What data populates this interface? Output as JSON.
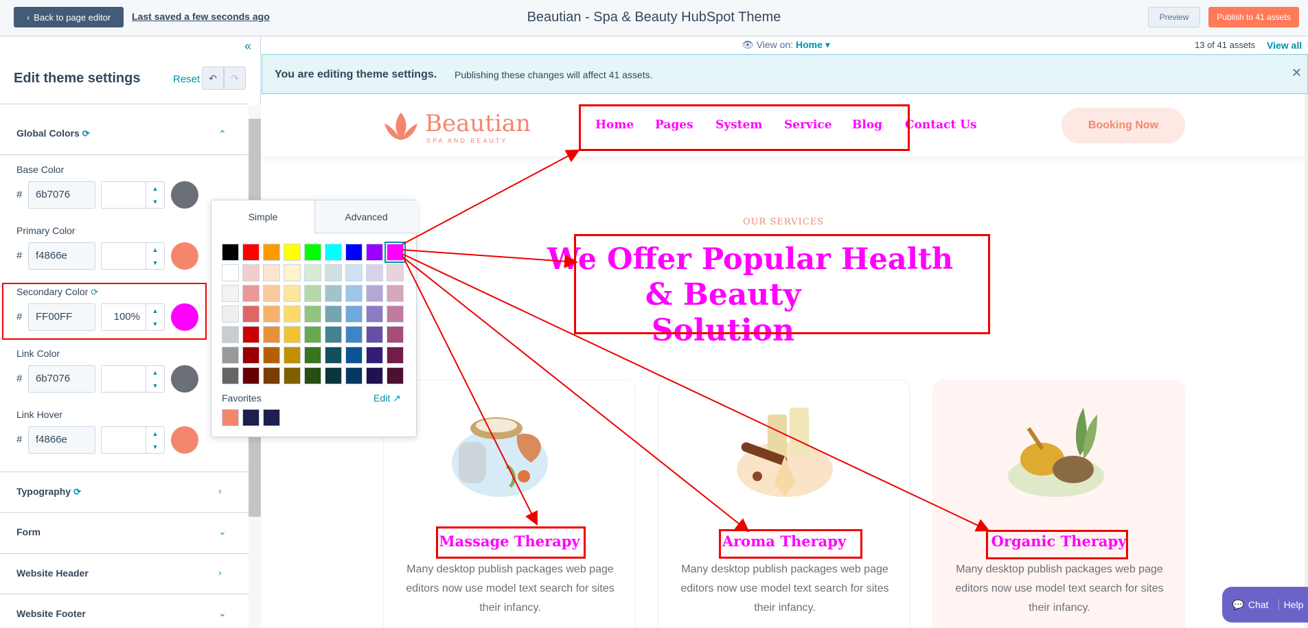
{
  "topbar": {
    "back_label": "Back to page editor",
    "saved": "Last saved a few seconds ago",
    "title": "Beautian - Spa & Beauty HubSpot Theme",
    "preview": "Preview",
    "publish": "Publish to 41 assets"
  },
  "viewbar": {
    "view_on": "View on:",
    "page": "Home",
    "assets": "13 of 41 assets",
    "view_all": "View all"
  },
  "banner": {
    "bold": "You are editing theme settings.",
    "text": "Publishing these changes will affect 41 assets."
  },
  "sidebar": {
    "title": "Edit theme settings",
    "reset": "Reset",
    "section_global": "Global Colors",
    "fields": [
      {
        "label": "Base Color",
        "hex": "6b7076",
        "opacity": "",
        "color": "#6b7076"
      },
      {
        "label": "Primary Color",
        "hex": "f4866e",
        "opacity": "",
        "color": "#f4866e"
      },
      {
        "label": "Secondary Color",
        "hex": "FF00FF",
        "opacity": "100%",
        "color": "#ff00ff"
      },
      {
        "label": "Link Color",
        "hex": "6b7076",
        "opacity": "",
        "color": "#6b7076"
      },
      {
        "label": "Link Hover",
        "hex": "f4866e",
        "opacity": "",
        "color": "#f4866e"
      }
    ],
    "sections": [
      "Typography",
      "Form",
      "Website Header",
      "Website Footer"
    ]
  },
  "picker": {
    "tab_simple": "Simple",
    "tab_advanced": "Advanced",
    "favorites": "Favorites",
    "edit": "Edit",
    "palette": [
      [
        "#000000",
        "#ff0000",
        "#ff9900",
        "#ffff00",
        "#00ff00",
        "#00ffff",
        "#0000ff",
        "#9900ff",
        "#ff00ff"
      ],
      [
        "#ffffff",
        "#f4cccc",
        "#fce5cd",
        "#fff2cc",
        "#d9ead3",
        "#d0e0e3",
        "#cfe2f3",
        "#d9d2e9",
        "#ead1dc"
      ],
      [
        "#f3f3f3",
        "#ea9999",
        "#f9cb9c",
        "#ffe599",
        "#b6d7a8",
        "#a2c4c9",
        "#9fc5e8",
        "#b4a7d6",
        "#d5a6bd"
      ],
      [
        "#efefef",
        "#e06666",
        "#f6b26b",
        "#ffd966",
        "#93c47d",
        "#76a5af",
        "#6fa8dc",
        "#8e7cc3",
        "#c27ba0"
      ],
      [
        "#cccccc",
        "#cc0000",
        "#e69138",
        "#f1c232",
        "#6aa84f",
        "#45818e",
        "#3d85c6",
        "#674ea7",
        "#a64d79"
      ],
      [
        "#999999",
        "#990000",
        "#b45f06",
        "#bf9000",
        "#38761d",
        "#134f5c",
        "#0b5394",
        "#351c75",
        "#741b47"
      ],
      [
        "#666666",
        "#660000",
        "#783f04",
        "#7f6000",
        "#274e13",
        "#0c343d",
        "#073763",
        "#20124d",
        "#4c1130"
      ]
    ],
    "favorite_colors": [
      "#f4866e",
      "#1f1f4f",
      "#1f1f4f"
    ]
  },
  "site": {
    "logo": "Beautian",
    "logo_sub": "SPA AND BEAUTY",
    "nav": [
      "Home",
      "Pages",
      "System",
      "Service",
      "Blog",
      "Contact Us"
    ],
    "booking": "Booking Now",
    "subheading": "OUR SERVICES",
    "heading_line1": "We Offer Popular Health",
    "heading_line2": "& Beauty Solution",
    "cards": [
      {
        "title": "Massage Therapy",
        "text": "Many desktop publish packages web page editors now use model text search for sites their infancy."
      },
      {
        "title": "Aroma Therapy",
        "text": "Many desktop publish packages web page editors now use model text search for sites their infancy."
      },
      {
        "title": "Organic Therapy",
        "text": "Many desktop publish packages web page editors now use model text search for sites their infancy."
      }
    ]
  },
  "chat": {
    "chat": "Chat",
    "help": "Help"
  },
  "colors": {
    "accent": "#0091ae",
    "brand": "#f4866e",
    "secondary": "#ff00ff",
    "annotation": "#ee0000"
  }
}
